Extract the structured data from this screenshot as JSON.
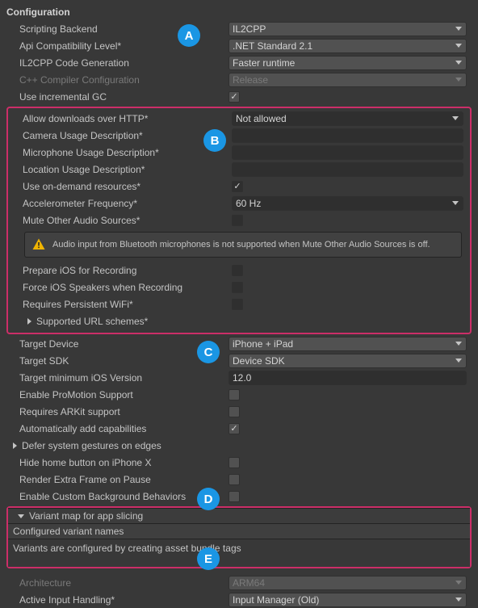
{
  "section": {
    "title": "Configuration"
  },
  "top": {
    "scriptingBackend": {
      "label": "Scripting Backend",
      "value": "IL2CPP"
    },
    "apiCompat": {
      "label": "Api Compatibility Level*",
      "value": ".NET Standard 2.1"
    },
    "il2cppCodeGen": {
      "label": "IL2CPP Code Generation",
      "value": "Faster runtime"
    },
    "cppCompiler": {
      "label": "C++ Compiler Configuration",
      "value": "Release"
    },
    "incrementalGC": {
      "label": "Use incremental GC",
      "checked": true
    }
  },
  "boxB": {
    "allowHttp": {
      "label": "Allow downloads over HTTP*",
      "value": "Not allowed"
    },
    "cameraDesc": {
      "label": "Camera Usage Description*",
      "value": ""
    },
    "micDesc": {
      "label": "Microphone Usage Description*",
      "value": ""
    },
    "locationDesc": {
      "label": "Location Usage Description*",
      "value": ""
    },
    "onDemand": {
      "label": "Use on-demand resources*",
      "checked": true
    },
    "accelFreq": {
      "label": "Accelerometer Frequency*",
      "value": "60 Hz"
    },
    "muteOther": {
      "label": "Mute Other Audio Sources*",
      "checked": false
    },
    "warning": "Audio input from Bluetooth microphones is not supported when Mute Other Audio Sources is off.",
    "prepareRec": {
      "label": "Prepare iOS for Recording",
      "checked": false
    },
    "forceSpeakers": {
      "label": "Force iOS Speakers when Recording",
      "checked": false
    },
    "persistentWifi": {
      "label": "Requires Persistent WiFi*",
      "checked": false
    },
    "urlSchemes": {
      "label": "Supported URL schemes*"
    }
  },
  "mid": {
    "targetDevice": {
      "label": "Target Device",
      "value": "iPhone + iPad"
    },
    "targetSDK": {
      "label": "Target SDK",
      "value": "Device SDK"
    },
    "minIOS": {
      "label": "Target minimum iOS Version",
      "value": "12.0"
    },
    "proMotion": {
      "label": "Enable ProMotion Support",
      "checked": false
    },
    "arkit": {
      "label": "Requires ARKit support",
      "checked": false
    },
    "autoCaps": {
      "label": "Automatically add capabilities",
      "checked": true
    },
    "deferGestures": {
      "label": "Defer system gestures on edges"
    },
    "hideHome": {
      "label": "Hide home button on iPhone X",
      "checked": false
    },
    "renderExtra": {
      "label": "Render Extra Frame on Pause",
      "checked": false
    },
    "customBg": {
      "label": "Enable Custom Background Behaviors",
      "checked": false
    }
  },
  "boxD": {
    "header": "Variant map for app slicing",
    "configured": "Configured variant names",
    "desc": "Variants are configured by creating asset bundle tags"
  },
  "bottom": {
    "architecture": {
      "label": "Architecture",
      "value": "ARM64"
    },
    "inputHandling": {
      "label": "Active Input Handling*",
      "value": "Input Manager (Old)"
    }
  },
  "badges": {
    "A": "A",
    "B": "B",
    "C": "C",
    "D": "D",
    "E": "E"
  }
}
